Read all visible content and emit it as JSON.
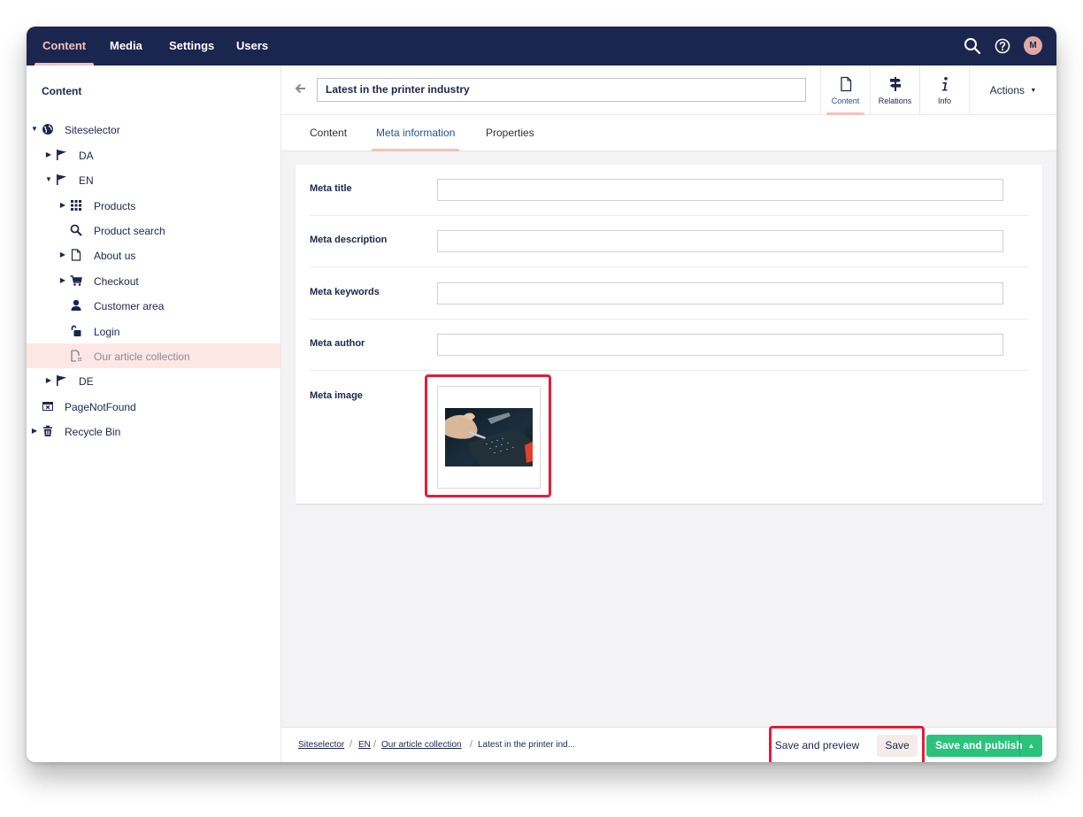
{
  "topnav": {
    "items": [
      "Content",
      "Media",
      "Settings",
      "Users"
    ],
    "active": "Content",
    "avatar_initial": "M"
  },
  "sidebar": {
    "title": "Content",
    "items": [
      {
        "label": "Siteselector",
        "icon": "globe-icon"
      },
      {
        "label": "DA",
        "icon": "flag-icon"
      },
      {
        "label": "EN",
        "icon": "flag-icon"
      },
      {
        "label": "Products",
        "icon": "grid-icon"
      },
      {
        "label": "Product search",
        "icon": "search-icon"
      },
      {
        "label": "About us",
        "icon": "document-icon"
      },
      {
        "label": "Checkout",
        "icon": "cart-icon"
      },
      {
        "label": "Customer area",
        "icon": "user-icon"
      },
      {
        "label": "Login",
        "icon": "unlock-icon"
      },
      {
        "label": "Our article collection",
        "icon": "document-list-icon"
      },
      {
        "label": "DE",
        "icon": "flag-icon"
      },
      {
        "label": "PageNotFound",
        "icon": "window-close-icon"
      },
      {
        "label": "Recycle Bin",
        "icon": "trash-icon"
      }
    ]
  },
  "editor": {
    "name": "Latest in the printer industry",
    "apps": [
      "Content",
      "Relations",
      "Info"
    ],
    "actions_label": "Actions",
    "tabs": [
      "Content",
      "Meta information",
      "Properties"
    ],
    "active_tab": "Meta information",
    "properties": [
      {
        "label": "Meta title",
        "value": ""
      },
      {
        "label": "Meta description",
        "value": ""
      },
      {
        "label": "Meta keywords",
        "value": ""
      },
      {
        "label": "Meta author",
        "value": ""
      },
      {
        "label": "Meta image",
        "value": ""
      }
    ]
  },
  "footer": {
    "breadcrumb": [
      "Siteselector",
      "EN",
      "Our article collection",
      "Latest in the printer ind..."
    ],
    "save_preview_label": "Save and preview",
    "save_label": "Save",
    "publish_label": "Save and publish"
  },
  "colors": {
    "topbar": "#1b264f",
    "accent": "#f5c1bc",
    "publish": "#2bc37c",
    "highlight": "#e11d3b",
    "selected_row": "#fde7e4"
  }
}
